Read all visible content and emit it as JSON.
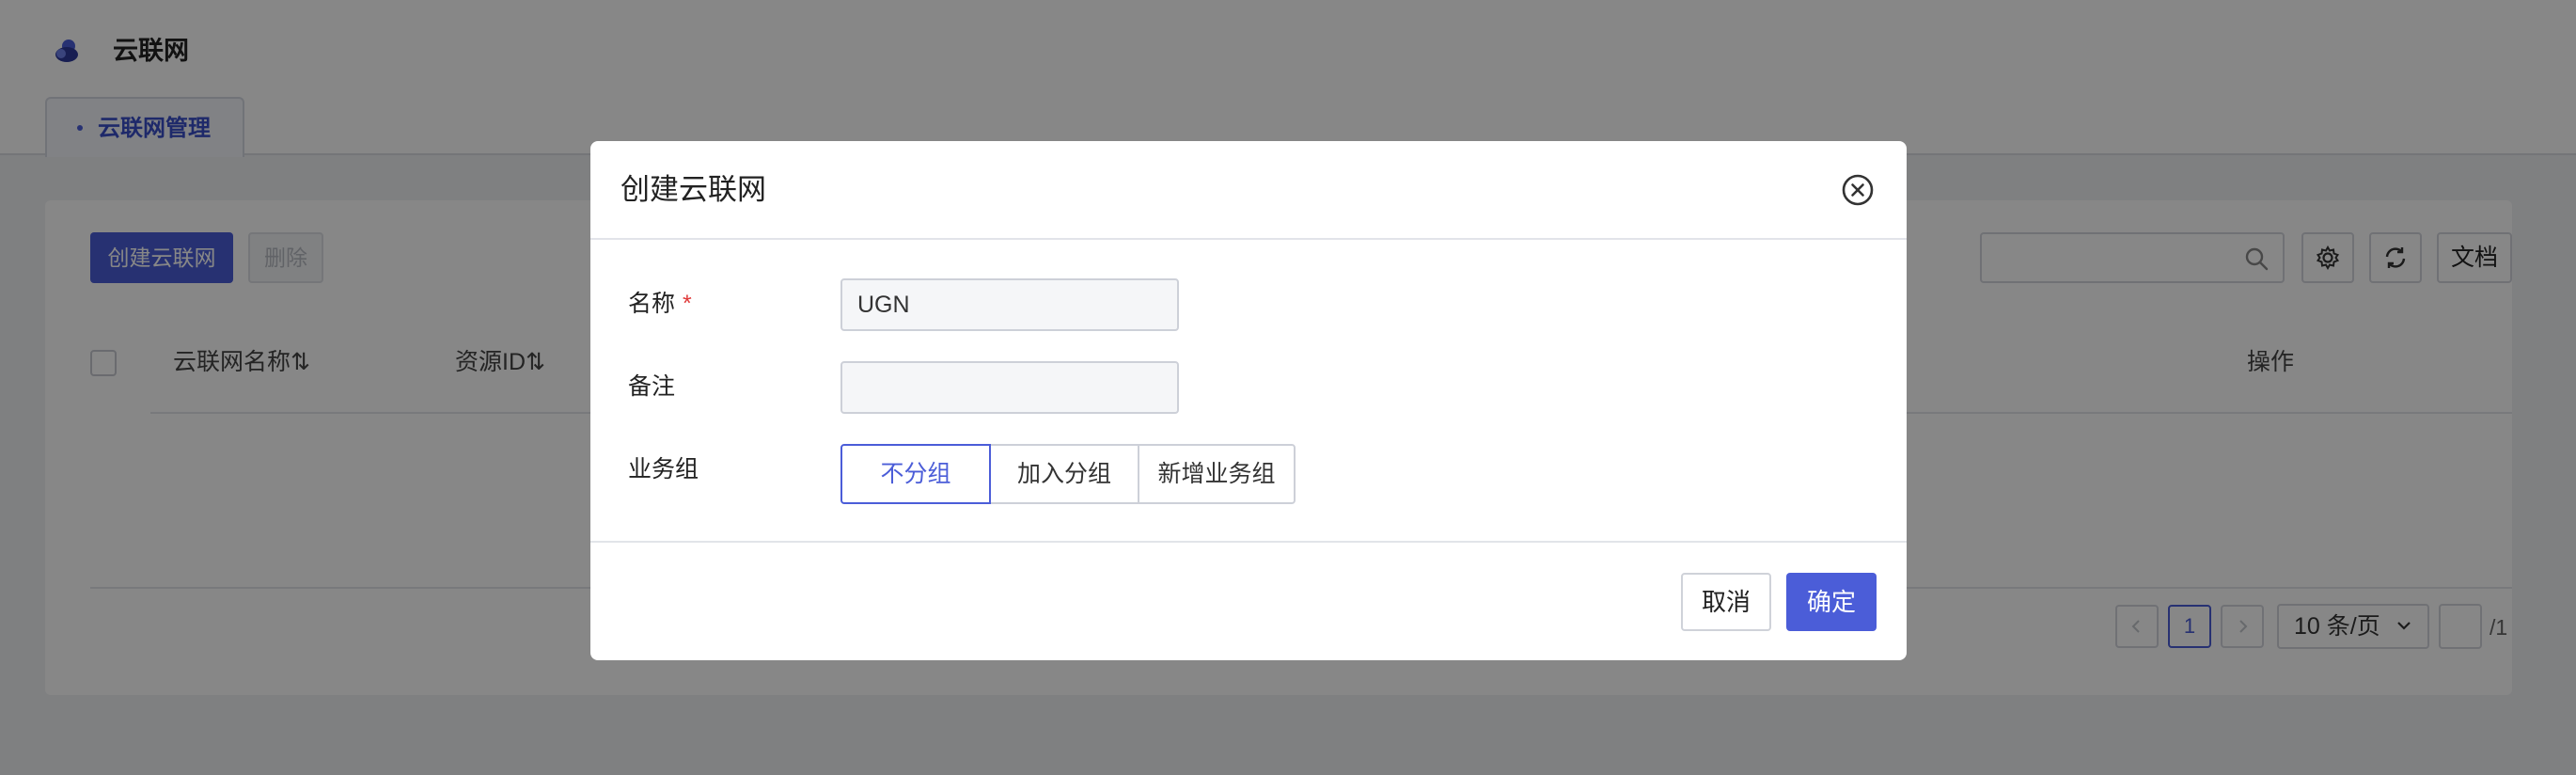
{
  "app": {
    "title": "云联网"
  },
  "tabs": [
    {
      "label": "云联网管理"
    }
  ],
  "toolbar": {
    "create_label": "创建云联网",
    "delete_label": "删除",
    "search_placeholder": "",
    "docs_label": "文档"
  },
  "table": {
    "columns": [
      {
        "label": "云联网名称⇅"
      },
      {
        "label": "资源ID⇅"
      },
      {
        "label": "操作"
      }
    ],
    "rows": []
  },
  "pagination": {
    "current_page": "1",
    "page_size": "10 条/页",
    "total": "/1",
    "jump_value": ""
  },
  "modal": {
    "title": "创建云联网",
    "fields": {
      "name": {
        "label": "名称",
        "required_mark": "*",
        "value": "UGN"
      },
      "remark": {
        "label": "备注",
        "value": ""
      },
      "group": {
        "label": "业务组",
        "options": [
          "不分组",
          "加入分组",
          "新增业务组"
        ],
        "selected": "不分组"
      }
    },
    "cancel_label": "取消",
    "confirm_label": "确定"
  },
  "colors": {
    "accent": "#4b5dd8",
    "required": "#e03a3a",
    "overlay": "rgba(0,0,0,0.47)"
  },
  "icons": [
    "cloud-logo-icon",
    "search-icon",
    "gear-icon",
    "refresh-icon",
    "close-circle-icon",
    "chevron-left-icon",
    "chevron-right-icon",
    "chevron-down-icon"
  ]
}
